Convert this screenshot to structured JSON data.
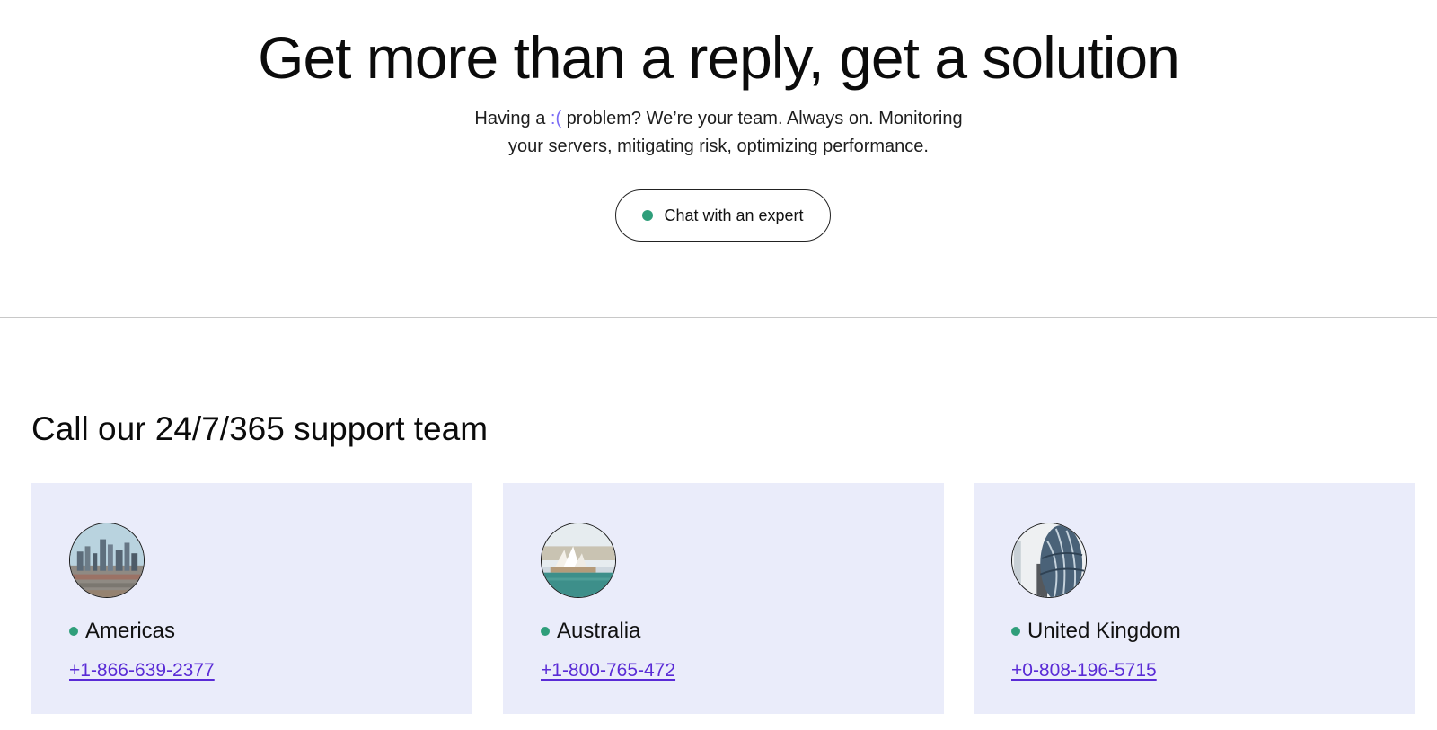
{
  "hero": {
    "title": "Get more than a reply, get a solution",
    "subtitle_prefix": "Having a ",
    "subtitle_emoticon": ":(",
    "subtitle_line1_rest": " problem? We’re your team. Always on. Monitoring",
    "subtitle_line2": "your servers, mitigating risk, optimizing performance.",
    "chat_button_label": "Chat with an expert"
  },
  "support": {
    "title": "Call our 24/7/365 support team",
    "regions": [
      {
        "name": "Americas",
        "phone": "+1-866-639-2377",
        "image": "city-skyline-image"
      },
      {
        "name": "Australia",
        "phone": "+1-800-765-472",
        "image": "sydney-opera-house-image"
      },
      {
        "name": "United Kingdom",
        "phone": "+0-808-196-5715",
        "image": "london-gherkin-image"
      }
    ]
  },
  "colors": {
    "accent_link": "#5a2bd6",
    "emoticon": "#7b6cf6",
    "status_online": "#2f9e7a",
    "card_background": "#eaecfa"
  }
}
